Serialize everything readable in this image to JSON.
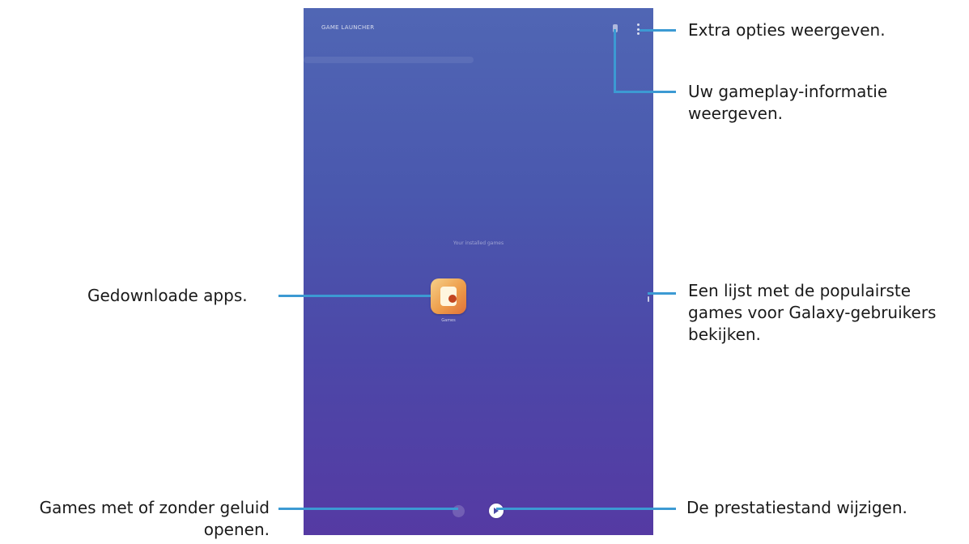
{
  "screen": {
    "app_title": "GAME LAUNCHER",
    "empty_hint": "Your installed games",
    "game_label": "Games"
  },
  "callouts": {
    "more_options": "Extra opties weergeven.",
    "gameplay_info_line1": "Uw gameplay-informatie",
    "gameplay_info_line2": "weergeven.",
    "downloaded_apps": "Gedownloade apps.",
    "popular_games_line1": "Een lijst met de populairste",
    "popular_games_line2": "games voor Galaxy-gebruikers",
    "popular_games_line3": "bekijken.",
    "mute_line1": "Games met of zonder geluid",
    "mute_line2": "openen.",
    "performance_mode": "De prestatiestand wijzigen."
  },
  "colors": {
    "callout_line": "#3c9ad3",
    "screen_top": "#5066b4",
    "screen_bottom": "#553aa3"
  },
  "icons": [
    "stats-icon",
    "more-options-icon",
    "game-app-icon",
    "edge-handle-icon",
    "mute-icon",
    "performance-mode-icon"
  ]
}
